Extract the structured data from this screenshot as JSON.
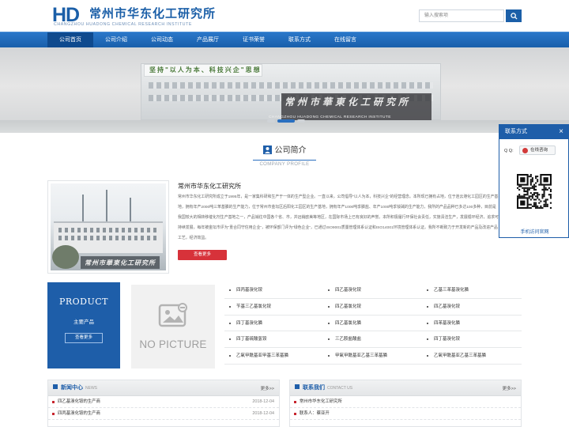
{
  "header": {
    "logo_mark": "HD",
    "logo_cn": "常州市华东化工研究所",
    "logo_en": "CHANGZHOU HUADONG CHEMICAL RESEARCH INSTITUTE",
    "search_placeholder": "输入搜索项",
    "search_icon": "search-icon"
  },
  "nav": {
    "items": [
      "公司首页",
      "公司介绍",
      "公司动态",
      "产品展厅",
      "证书荣誉",
      "联系方式",
      "在线留言"
    ],
    "active_index": 0
  },
  "banner": {
    "slogan": "坚持\"以人为本、科技兴企\"思想",
    "sign_cn": "常州市華東化工研究所",
    "sign_en": "CHANGZHOU HUADONG CHEMICAL RESEARCH INSTITUTE",
    "slide_count": 3,
    "active_slide": 1
  },
  "intro": {
    "section_title": "公司简介",
    "section_subtitle": "COMPANY PROFILE",
    "title": "常州市华东化工研究所",
    "text": "常州市华东化工研究所成立于1995年，是一家集科研和生产于一体的生产型企业。一直以来，公司倡导“以人为本，科技兴企”的经营理念。本所现已拥有占地，位于连云港化工园区的生产基地，拥有年产2000吨三苯基膦的生产能力，位于常州市金坛区后阳化工园区的生产基地，拥有年产1000吨季膦盐、年产1000吨季铵碱的生产能力，我所的产品品种已多达100多种，目前是我国较大的相转移催化剂生产基地之一，产品销往中国各个省、市，并远销欧美等地区，在国际市场上已有良好的声誉。本所积极履行环保社会责任，实施清洁生产，发展循环经济，追求可持续发展，每年被金坛市评为“重合同守信用企业”，被环保部门评为“绿色企业”，已通过ISO9001质量管理体系认证和ISO14001环境管理体系认证。我所不断致力于开发新的产品及改进产品工艺，经济效益。",
    "more_label": "查看更多"
  },
  "products": {
    "panel_en": "PRODUCT",
    "panel_cn": "主要产品",
    "panel_more": "查看更多",
    "no_picture": "NO PICTURE",
    "rows": [
      [
        "四丙基溴化铵",
        "四乙基溴化铵",
        "乙基三苯基溴化膦"
      ],
      [
        "苄基三乙基氯化铵",
        "四乙基氯化铵",
        "四乙基溴化铵"
      ],
      [
        "四丁基溴化膦",
        "四乙基氯化膦",
        "四苯基溴化膦"
      ],
      [
        "四丁基硫酸氢铵",
        "三乙胺盐酸盐",
        "四丁基溴化铵"
      ],
      [
        "乙氧甲酰基亚甲基三苯基膦",
        "甲氧甲酰基亚乙基三苯基膦",
        "乙氧甲酰基亚乙基三苯基膦"
      ]
    ]
  },
  "news": {
    "title": "新闻中心",
    "title_en": "NEWS",
    "more": "更多>>",
    "items": [
      {
        "title": "四乙基溴化铵的生产商",
        "date": "2018-12-04"
      },
      {
        "title": "四丙基溴化铵的生产商",
        "date": "2018-12-04"
      }
    ]
  },
  "contact": {
    "title": "联系我们",
    "title_en": "CONTACT US",
    "more": "更多>>",
    "items": [
      "常州市华东化工研究所",
      "联系人：蔡亚开"
    ]
  },
  "float_contact": {
    "title": "联系方式",
    "close": "×",
    "qq_label": "Q Q:",
    "qq_button": "在线咨询",
    "caption": "手机访问官网"
  },
  "colors": {
    "brand_blue": "#1e5ea9",
    "nav_blue": "#2a77c9",
    "accent_red": "#d7323a"
  }
}
